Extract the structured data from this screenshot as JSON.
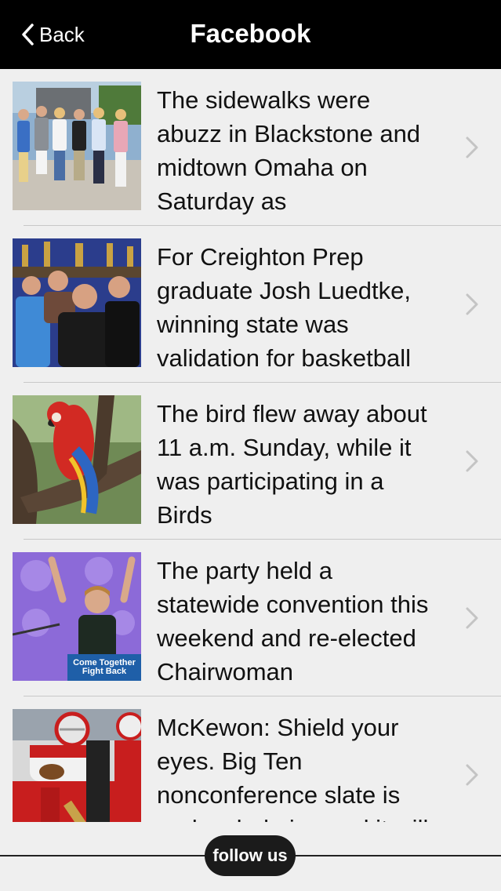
{
  "nav": {
    "back_label": "Back",
    "title": "Facebook"
  },
  "items": [
    {
      "text": "The sidewalks were abuzz in Blackstone and midtown Omaha on Saturday as"
    },
    {
      "text": "For Creighton Prep graduate Josh Luedtke, winning state was validation for basketball"
    },
    {
      "text": "The bird flew away about 11 a.m. Sunday, while it was participating in a Birds"
    },
    {
      "text": "The party held a statewide convention this weekend and re-elected Chairwoman",
      "image_caption": "Come Together Fight Back"
    },
    {
      "text": "McKewon: Shield your eyes. Big Ten nonconference slate is underwhelming and it will only get"
    }
  ],
  "footer": {
    "follow_label": "follow us"
  },
  "colors": {
    "navbar_bg": "#000000",
    "list_bg": "#efefef",
    "chevron": "#c4c4c4",
    "follow_bg": "#1b1b1b"
  }
}
